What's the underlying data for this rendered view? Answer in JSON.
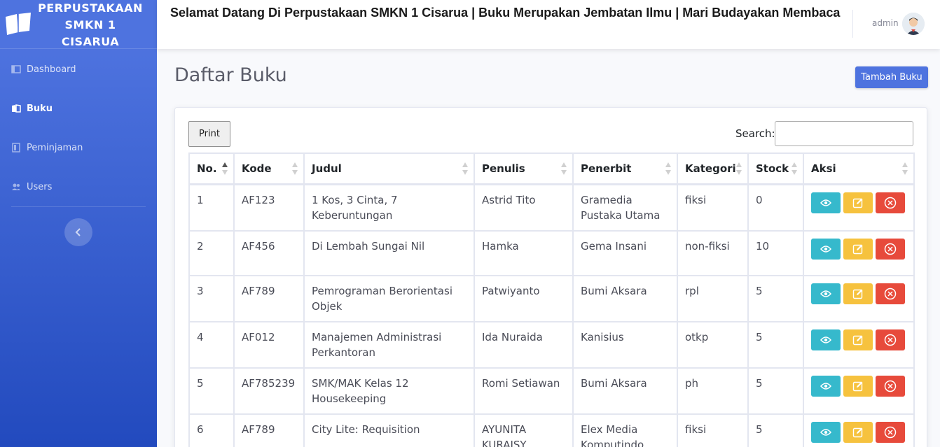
{
  "brand": {
    "line1": "PERPUSTAKAAN",
    "line2": "SMKN 1",
    "line3": "CISARUA"
  },
  "sidebar": {
    "items": [
      {
        "label": "Dashboard",
        "icon": "dashboard-icon",
        "active": false
      },
      {
        "label": "Buku",
        "icon": "book-icon",
        "active": true
      },
      {
        "label": "Peminjaman",
        "icon": "loan-icon",
        "active": false
      },
      {
        "label": "Users",
        "icon": "users-icon",
        "active": false
      }
    ]
  },
  "topbar": {
    "marquee": "Selamat Datang Di Perpustakaan SMKN 1 Cisarua | Buku Merupakan Jembatan Ilmu | Mari Budayakan Membaca",
    "user": "admin"
  },
  "page": {
    "title": "Daftar Buku",
    "add_button": "Tambah Buku",
    "print_button": "Print",
    "search_label": "Search:",
    "search_value": ""
  },
  "table": {
    "headers": [
      "No.",
      "Kode",
      "Judul",
      "Penulis",
      "Penerbit",
      "Kategori",
      "Stock",
      "Aksi"
    ],
    "rows": [
      {
        "no": "1",
        "kode": "AF123",
        "judul": "1 Kos, 3 Cinta, 7 Keberuntungan",
        "penulis": "Astrid Tito",
        "penerbit": "Gramedia Pustaka Utama",
        "kategori": "fiksi",
        "stock": "0"
      },
      {
        "no": "2",
        "kode": "AF456",
        "judul": "Di Lembah Sungai Nil",
        "penulis": "Hamka",
        "penerbit": "Gema Insani",
        "kategori": "non-fiksi",
        "stock": "10"
      },
      {
        "no": "3",
        "kode": "AF789",
        "judul": "Pemrograman Berorientasi Objek",
        "penulis": "Patwiyanto",
        "penerbit": "Bumi Aksara",
        "kategori": "rpl",
        "stock": "5"
      },
      {
        "no": "4",
        "kode": "AF012",
        "judul": "Manajemen Administrasi Perkantoran",
        "penulis": "Ida Nuraida",
        "penerbit": "Kanisius",
        "kategori": "otkp",
        "stock": "5"
      },
      {
        "no": "5",
        "kode": "AF785239",
        "judul": "SMK/MAK Kelas 12 Housekeeping",
        "penulis": "Romi Setiawan",
        "penerbit": "Bumi Aksara",
        "kategori": "ph",
        "stock": "5"
      },
      {
        "no": "6",
        "kode": "AF789",
        "judul": "City Lite: Requisition",
        "penulis": "AYUNITA KURAISY",
        "penerbit": "Elex Media Komputindo",
        "kategori": "fiksi",
        "stock": "5"
      }
    ]
  },
  "colors": {
    "primary": "#4e73df",
    "info": "#36b9cc",
    "warning": "#f6c23e",
    "danger": "#e74a3b"
  }
}
